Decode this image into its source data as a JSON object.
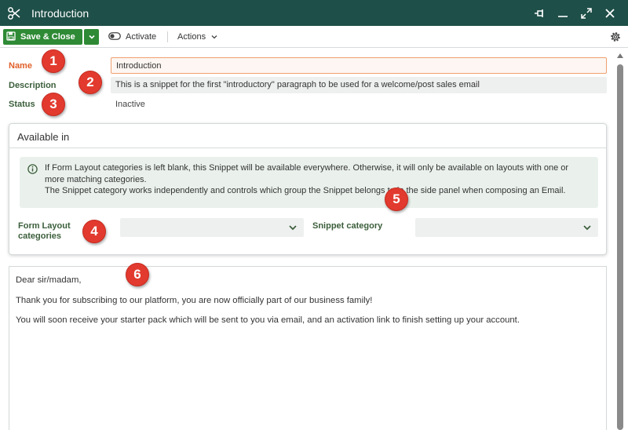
{
  "window": {
    "title": "Introduction"
  },
  "toolbar": {
    "save_close_label": "Save & Close",
    "activate_label": "Activate",
    "actions_label": "Actions"
  },
  "form": {
    "name_label": "Name",
    "name_value": "Introduction",
    "description_label": "Description",
    "description_value": "This is a snippet for the first \"introductory\" paragraph to be used for a welcome/post sales email",
    "status_label": "Status",
    "status_value": "Inactive"
  },
  "available_in": {
    "title": "Available in",
    "info_text": "If Form Layout categories is left blank, this Snippet will be available everywhere. Otherwise, it will only be available on layouts with one or more matching categories.",
    "info_text_2": "The Snippet category works independently and controls which group the Snippet belongs to in the side panel when composing an Email.",
    "form_layout_label": "Form Layout categories",
    "form_layout_value": "",
    "snippet_category_label": "Snippet category",
    "snippet_category_value": ""
  },
  "editor": {
    "lines": [
      "Dear sir/madam,",
      "Thank you for subscribing to our platform, you are now officially part of our business family!",
      "You will soon receive your starter pack which will be sent to you via email, and an activation link to finish setting up your account."
    ]
  },
  "markers": [
    "1",
    "2",
    "3",
    "4",
    "5",
    "6"
  ],
  "colors": {
    "titlebar": "#1e4f48",
    "save_button": "#2e8a35",
    "required_label": "#e0602a",
    "field_label": "#3b5e3b",
    "marker": "#e23a2e",
    "info_box": "#eaf1ec"
  },
  "icons": [
    "scissors-icon",
    "pin-icon",
    "minimize-icon",
    "maximize-icon",
    "close-icon",
    "save-icon",
    "chevron-down-icon",
    "toggle-icon",
    "gear-icon",
    "info-icon"
  ]
}
